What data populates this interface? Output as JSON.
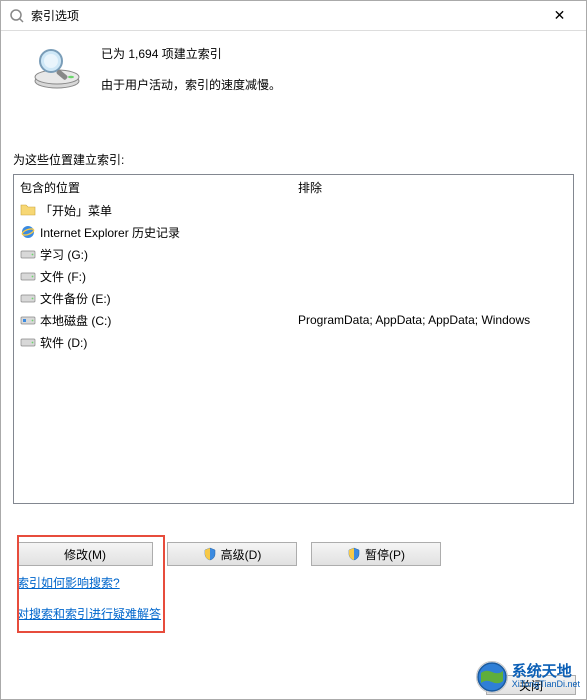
{
  "titlebar": {
    "title": "索引选项",
    "close_symbol": "✕"
  },
  "status": {
    "line1": "已为 1,694 项建立索引",
    "line2": "由于用户活动，索引的速度减慢。"
  },
  "section_label": "为这些位置建立索引:",
  "list": {
    "header_col1": "包含的位置",
    "header_col2": "排除",
    "rows": [
      {
        "icon": "folder",
        "label": "「开始」菜单",
        "exclude": ""
      },
      {
        "icon": "ie",
        "label": "Internet Explorer 历史记录",
        "exclude": ""
      },
      {
        "icon": "drive",
        "label": "学习 (G:)",
        "exclude": ""
      },
      {
        "icon": "drive",
        "label": "文件 (F:)",
        "exclude": ""
      },
      {
        "icon": "drive",
        "label": "文件备份 (E:)",
        "exclude": ""
      },
      {
        "icon": "sysdrive",
        "label": "本地磁盘 (C:)",
        "exclude": "ProgramData; AppData; AppData; Windows"
      },
      {
        "icon": "drive",
        "label": "软件 (D:)",
        "exclude": ""
      }
    ]
  },
  "buttons": {
    "modify": "修改(M)",
    "advanced": "高级(D)",
    "pause": "暂停(P)",
    "close": "关闭"
  },
  "links": {
    "link1": "索引如何影响搜索?",
    "link2": "对搜索和索引进行疑难解答"
  },
  "watermark": {
    "cn": "系统天地",
    "en": "XiTongTianDi.net"
  }
}
